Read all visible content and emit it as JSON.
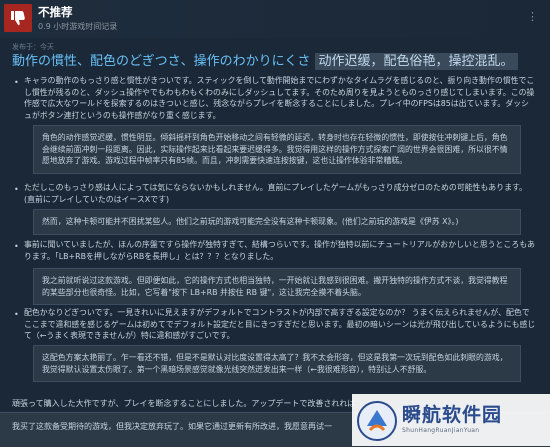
{
  "review": {
    "verdict": "不推荐",
    "hours": "0.9 小时游戏时间记录",
    "menu": "⋮",
    "posted": "发布于：今天",
    "headline_main": "動作の慣性、配色のどぎつさ、操作のわかりにくさ",
    "headline_highlight": "动作迟缓，配色俗艳，操控混乱。"
  },
  "bullets": [
    {
      "text": "キャラの動作のもっさり感と慣性がきついです。スティックを倒して動作開始までにわずかなタイムラグを感じるのと、振り向き動作の慣性でこし慣性が残るのと、ダッシュ操作やでもわもわもくわのみにしダッシュしてます。そのため周りを見ようとものっさり感じてしまいます。この操作感で広大なワールドを探索するのはきついと感じ、残念ながらプレイを断念することにしました。プレイ中のFPSは85は出ています。ダッシュがボタン連打というのも操作感がなり重く感じます。",
      "quote": "角色的动作感觉迟缓，惯性明显。倾斜摇杆到角色开始移动之间有轻微的延迟，转身时也存在轻微的惯性，即使按住冲刺键上后，角色会继续前面冲刺一段距离。因此，实际操作起来比看起来要迟缓得多。我觉得用这样的操作方式探索广阔的世界会很困难，所以很不情愿地放弃了游戏。游戏过程中帧率只有85帧。而且，冲刺需要快速连按按键，这也让操作体验非常糟糕。"
    },
    {
      "text": "ただしこのもっさり感は人によっては気にならないかもしれません。直前にプレイしたゲームがもっさり成分ゼロのための可能性もあります。(直前にプレイしていたのはイースXです)",
      "quote": "然而，这种卡顿可能并不困扰某些人。他们之前玩的游戏可能完全没有这种卡顿现象。(他们之前玩的游戏是《伊苏 X》。)"
    },
    {
      "text": "事前に聞いていましたが、ほんの序盤ですら操作が独特すぎて、結構つらいです。操作が独特以前にチュートリアルがおかしいと思うところもあります。「LB+RBを押しながらRBを長押し」とは？？？となりました。",
      "quote": "我之前就听说过这款游戏。但即便如此，它的操作方式也相当独特，一开始就让我感到很困难。撇开独特的操作方式不谈，我觉得教程的某些部分也很奇怪。比如，它写着\"按下 LB+RB 并按住 RB 键\"，这让我完全摸不着头脑。"
    },
    {
      "text": "配色かなりどぎついです。一見きれいに見えますがデフォルトでコントラストが内部で高すぎる設定なのか？ うまく伝えられませんが、配色でここまで違和感を感じるゲームは初めてでデフォルト設定だと目にきつすぎだと思います。最初の暗いシーンは光が飛び出しているようにも感じて（←うまく表現できませんが）特に違和感がすごいです。",
      "quote": "这配色方案太艳丽了。乍一看还不错，但是不是默认对比度设置得太高了？我不太会形容，但这是我第一次玩到配色如此刺眼的游戏，我觉得默认设置太伤眼了。第一个黑暗场景感觉就像光线突然迸发出来一样（←我很难形容），特别让人不舒服。"
    }
  ],
  "footer": {
    "line": "頑張って購入した大作ですが、プレイを断念することにしました。アップデートで改善されれば",
    "quote": "我买了这款备受期待的游戏，但我决定放弃玩了。如果它通过更新有所改进，我愿意再试一"
  },
  "watermark": {
    "title": "瞬航软件园",
    "subtitle": "ShunHangRuanJianYuan"
  },
  "colors": {
    "background": "#1b2838",
    "negative": "#a6271f",
    "headline": "#67c1f5",
    "quote_bg": "#2c3947"
  }
}
